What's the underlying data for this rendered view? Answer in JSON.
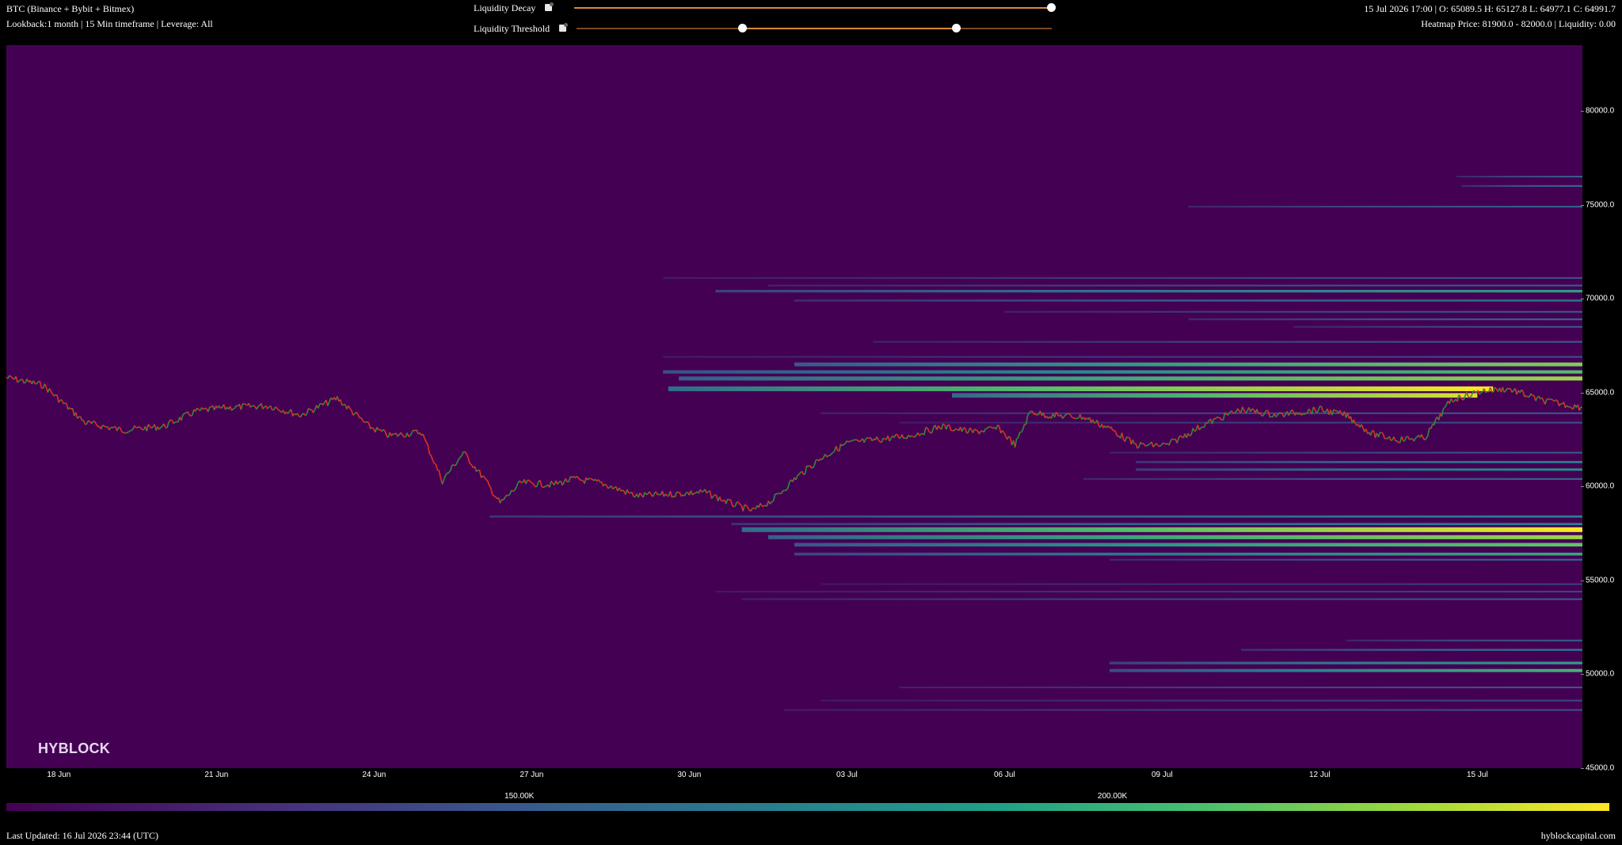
{
  "header": {
    "title": "BTC (Binance + Bybit + Bitmex)",
    "subtitle": "Lookback:1 month | 15 Min timeframe | Leverage: All",
    "ohlc": "15 Jul 2026 17:00 | O: 65089.5 H: 65127.8 L: 64977.1 C: 64991.7",
    "heatmap_info": "Heatmap Price: 81900.0 - 82000.0 | Liquidity: 0.00"
  },
  "controls": {
    "decay": {
      "label": "Liquidity Decay",
      "value": 1.0
    },
    "threshold": {
      "label": "Liquidity Threshold",
      "low": 0.35,
      "high": 0.8
    }
  },
  "brand": {
    "logo": "HYBLOCK",
    "site": "hyblockcapital.com"
  },
  "footer": {
    "updated": "Last Updated: 16 Jul 2026 23:44 (UTC)"
  },
  "colors": {
    "background": "#440154",
    "candle_up": "#2e8b3a",
    "candle_down": "#e0301e",
    "accent": "#d98a3a"
  },
  "colorbar": {
    "ticks": [
      {
        "label": "150.00K",
        "pos": 0.32
      },
      {
        "label": "200.00K",
        "pos": 0.69
      }
    ]
  },
  "chart_data": {
    "type": "heatmap",
    "title": "BTC (Binance + Bybit + Bitmex)",
    "xlabel": "",
    "ylabel": "",
    "x_ticks": [
      {
        "label": "18 Jun",
        "day": 1
      },
      {
        "label": "21 Jun",
        "day": 4
      },
      {
        "label": "24 Jun",
        "day": 7
      },
      {
        "label": "27 Jun",
        "day": 10
      },
      {
        "label": "30 Jun",
        "day": 13
      },
      {
        "label": "03 Jul",
        "day": 16
      },
      {
        "label": "06 Jul",
        "day": 19
      },
      {
        "label": "09 Jul",
        "day": 22
      },
      {
        "label": "12 Jul",
        "day": 25
      },
      {
        "label": "15 Jul",
        "day": 28
      }
    ],
    "y_ticks": [
      "80000.0",
      "75000.0",
      "70000.0",
      "65000.0",
      "60000.0",
      "55000.0",
      "50000.0",
      "45000.0"
    ],
    "ylim": [
      45000,
      83500
    ],
    "xlim_days": [
      0,
      30
    ],
    "price_path": [
      [
        0,
        65800
      ],
      [
        0.7,
        65400
      ],
      [
        1.5,
        63400
      ],
      [
        2.2,
        63000
      ],
      [
        3.0,
        63200
      ],
      [
        3.6,
        64000
      ],
      [
        4.2,
        64200
      ],
      [
        5.0,
        64300
      ],
      [
        5.6,
        63800
      ],
      [
        6.3,
        64700
      ],
      [
        6.9,
        63200
      ],
      [
        7.3,
        62700
      ],
      [
        7.9,
        62900
      ],
      [
        8.3,
        60300
      ],
      [
        8.7,
        61800
      ],
      [
        9.1,
        60400
      ],
      [
        9.4,
        59100
      ],
      [
        9.8,
        60200
      ],
      [
        10.4,
        60100
      ],
      [
        10.8,
        60400
      ],
      [
        11.3,
        60200
      ],
      [
        12.0,
        59500
      ],
      [
        12.7,
        59600
      ],
      [
        13.3,
        59700
      ],
      [
        13.7,
        59200
      ],
      [
        14.2,
        58700
      ],
      [
        14.6,
        59300
      ],
      [
        15.0,
        60400
      ],
      [
        15.5,
        61500
      ],
      [
        16.0,
        62300
      ],
      [
        16.6,
        62500
      ],
      [
        17.2,
        62700
      ],
      [
        17.8,
        63200
      ],
      [
        18.4,
        62900
      ],
      [
        18.9,
        63100
      ],
      [
        19.2,
        62200
      ],
      [
        19.5,
        64000
      ],
      [
        19.8,
        63800
      ],
      [
        20.5,
        63700
      ],
      [
        21.0,
        63100
      ],
      [
        21.5,
        62200
      ],
      [
        22.1,
        62200
      ],
      [
        22.8,
        63300
      ],
      [
        23.5,
        64100
      ],
      [
        24.2,
        63800
      ],
      [
        25.0,
        64100
      ],
      [
        25.5,
        63800
      ],
      [
        26.0,
        62800
      ],
      [
        26.5,
        62500
      ],
      [
        27.0,
        62600
      ],
      [
        27.5,
        64600
      ],
      [
        28.1,
        65100
      ],
      [
        28.6,
        65200
      ],
      [
        29.2,
        64600
      ],
      [
        30.0,
        64200
      ]
    ],
    "liquidity_bands": [
      {
        "price": 76500,
        "start": 27.6,
        "end": 30,
        "intensity": 0.3
      },
      {
        "price": 76000,
        "start": 27.7,
        "end": 30,
        "intensity": 0.35
      },
      {
        "price": 74900,
        "start": 22.5,
        "end": 30,
        "intensity": 0.32
      },
      {
        "price": 71100,
        "start": 12.5,
        "end": 30,
        "intensity": 0.25
      },
      {
        "price": 70700,
        "start": 14.5,
        "end": 30,
        "intensity": 0.32
      },
      {
        "price": 70400,
        "start": 13.5,
        "end": 30,
        "intensity": 0.55
      },
      {
        "price": 69900,
        "start": 15,
        "end": 30,
        "intensity": 0.4
      },
      {
        "price": 69300,
        "start": 19,
        "end": 30,
        "intensity": 0.3
      },
      {
        "price": 68900,
        "start": 22.5,
        "end": 30,
        "intensity": 0.35
      },
      {
        "price": 68500,
        "start": 24.5,
        "end": 30,
        "intensity": 0.3
      },
      {
        "price": 67700,
        "start": 16.5,
        "end": 30,
        "intensity": 0.3
      },
      {
        "price": 66900,
        "start": 12.5,
        "end": 30,
        "intensity": 0.25
      },
      {
        "price": 66500,
        "start": 15,
        "end": 30,
        "intensity": 0.8
      },
      {
        "price": 66100,
        "start": 12.5,
        "end": 30,
        "intensity": 0.7
      },
      {
        "price": 65750,
        "start": 12.8,
        "end": 30,
        "intensity": 0.85
      },
      {
        "price": 65200,
        "start": 12.6,
        "end": 28.3,
        "intensity": 1.0
      },
      {
        "price": 64850,
        "start": 18,
        "end": 28.0,
        "intensity": 0.95
      },
      {
        "price": 63900,
        "start": 15.5,
        "end": 30,
        "intensity": 0.3
      },
      {
        "price": 63400,
        "start": 17,
        "end": 30,
        "intensity": 0.25
      },
      {
        "price": 61800,
        "start": 21,
        "end": 30,
        "intensity": 0.3
      },
      {
        "price": 61300,
        "start": 21.5,
        "end": 30,
        "intensity": 0.45
      },
      {
        "price": 60900,
        "start": 21.5,
        "end": 30,
        "intensity": 0.5
      },
      {
        "price": 60400,
        "start": 20.5,
        "end": 30,
        "intensity": 0.35
      },
      {
        "price": 58400,
        "start": 9.2,
        "end": 30,
        "intensity": 0.45
      },
      {
        "price": 58000,
        "start": 13.8,
        "end": 30,
        "intensity": 0.45
      },
      {
        "price": 57700,
        "start": 14,
        "end": 30,
        "intensity": 1.0
      },
      {
        "price": 57300,
        "start": 14.5,
        "end": 30,
        "intensity": 0.85
      },
      {
        "price": 56900,
        "start": 15,
        "end": 30,
        "intensity": 0.75
      },
      {
        "price": 56400,
        "start": 15,
        "end": 30,
        "intensity": 0.6
      },
      {
        "price": 56100,
        "start": 21,
        "end": 30,
        "intensity": 0.35
      },
      {
        "price": 54800,
        "start": 15.5,
        "end": 30,
        "intensity": 0.2
      },
      {
        "price": 54400,
        "start": 13.5,
        "end": 30,
        "intensity": 0.22
      },
      {
        "price": 54000,
        "start": 14,
        "end": 30,
        "intensity": 0.3
      },
      {
        "price": 51800,
        "start": 25.5,
        "end": 30,
        "intensity": 0.32
      },
      {
        "price": 51300,
        "start": 23.5,
        "end": 30,
        "intensity": 0.4
      },
      {
        "price": 50600,
        "start": 21,
        "end": 30,
        "intensity": 0.55
      },
      {
        "price": 50200,
        "start": 21,
        "end": 30,
        "intensity": 0.65
      },
      {
        "price": 49300,
        "start": 17,
        "end": 30,
        "intensity": 0.28
      },
      {
        "price": 48600,
        "start": 15.5,
        "end": 30,
        "intensity": 0.22
      },
      {
        "price": 48100,
        "start": 14.8,
        "end": 30,
        "intensity": 0.25
      }
    ]
  }
}
